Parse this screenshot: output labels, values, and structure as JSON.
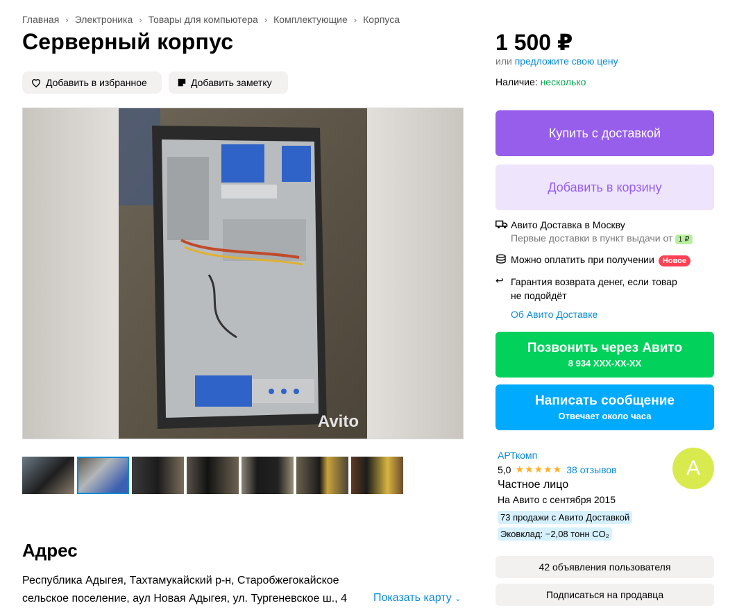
{
  "breadcrumb": [
    "Главная",
    "Электроника",
    "Товары для компьютера",
    "Комплектующие",
    "Корпуса"
  ],
  "title": "Серверный корпус",
  "actions": {
    "favorite": "Добавить в избранное",
    "note": "Добавить заметку"
  },
  "gallery": {
    "watermark": "Avito",
    "thumb_count": 7,
    "active_thumb": 2
  },
  "address": {
    "heading": "Адрес",
    "text": "Республика Адыгея, Тахтамукайский р-н, Старобжегокайское сельское поселение, аул Новая Адыгея, ул. Тургеневское ш., 4",
    "show_map": "Показать карту"
  },
  "price": {
    "value": "1 500 ₽",
    "offer_prefix": "или",
    "offer_link": "предложите свою цену",
    "stock_label": "Наличие:",
    "stock_value": "несколько"
  },
  "buttons": {
    "buy": "Купить с доставкой",
    "cart": "Добавить в корзину",
    "call_title": "Позвонить через Авито",
    "call_phone": "8 934 XXX-XX-XX",
    "message_title": "Написать сообщение",
    "message_sub": "Отвечает около часа"
  },
  "delivery": {
    "line1": "Авито Доставка в Москву",
    "line1_sub": "Первые доставки в пункт выдачи от",
    "line1_badge": "1 ₽",
    "line2": "Можно оплатить при получении",
    "line2_badge": "Новое",
    "line3": "Гарантия возврата денег, если товар не подойдёт",
    "about": "Об Авито Доставке"
  },
  "seller": {
    "name": "АРТкомп",
    "rating": "5,0",
    "stars": "★★★★★",
    "reviews": "38 отзывов",
    "type": "Частное лицо",
    "since": "На Авито с сентября 2015",
    "chip1": "73 продажи с Авито Доставкой",
    "chip2": "Эковклад: −2,08 тонн CO₂",
    "avatar_letter": "А"
  },
  "seller_buttons": {
    "ads": "42 объявления пользователя",
    "subscribe": "Подписаться на продавца"
  },
  "colors": {
    "accent_blue": "#0a8ad6",
    "purple": "#965eeb",
    "green": "#02d15c",
    "cyan": "#00aaff"
  }
}
